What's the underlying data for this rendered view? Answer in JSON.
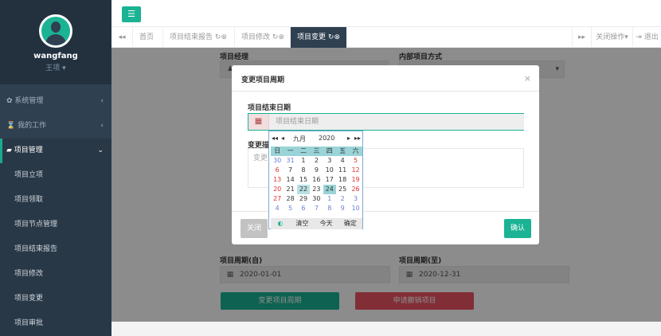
{
  "user": {
    "name": "wangfang",
    "role": "王项"
  },
  "menu": [
    {
      "label": "系统管理",
      "icon": "gear-icon"
    },
    {
      "label": "我的工作",
      "icon": "hourglass-icon"
    },
    {
      "label": "项目管理",
      "icon": "book-icon"
    }
  ],
  "submenu": [
    "项目立项",
    "项目领取",
    "项目节点管理",
    "项目结束报告",
    "项目修改",
    "项目变更",
    "项目审批"
  ],
  "tabs": [
    "首页",
    "项目结束报告",
    "项目修改",
    "项目变更"
  ],
  "topnav": {
    "close_ops": "关闭操作",
    "logout": "退出"
  },
  "form": {
    "manager_label": "项目经理",
    "internal_label": "内部项目方式",
    "period_start_label": "项目周期(自)",
    "period_end_label": "项目周期(至)",
    "period_start": "2020-01-01",
    "period_end": "2020-12-31",
    "change_btn": "变更项目周期",
    "cancel_btn": "申请撤销项目"
  },
  "modal": {
    "title": "变更项目周期",
    "end_date_label": "项目结束日期",
    "end_date_placeholder": "项目结束日期",
    "desc_label": "变更描",
    "desc_placeholder": "变更",
    "close_btn": "关闭",
    "ok_btn": "确认"
  },
  "calendar": {
    "month": "九月",
    "year": "2020",
    "weekdays": [
      "日",
      "一",
      "二",
      "三",
      "四",
      "五",
      "六"
    ],
    "weeks": [
      [
        "30",
        "31",
        "1",
        "2",
        "3",
        "4",
        "5"
      ],
      [
        "6",
        "7",
        "8",
        "9",
        "10",
        "11",
        "12"
      ],
      [
        "13",
        "14",
        "15",
        "16",
        "17",
        "18",
        "19"
      ],
      [
        "20",
        "21",
        "22",
        "23",
        "24",
        "25",
        "26"
      ],
      [
        "27",
        "28",
        "29",
        "30",
        "1",
        "2",
        "3"
      ],
      [
        "4",
        "5",
        "6",
        "7",
        "8",
        "9",
        "10"
      ]
    ],
    "clear": "清空",
    "today": "今天",
    "ok": "确定"
  }
}
